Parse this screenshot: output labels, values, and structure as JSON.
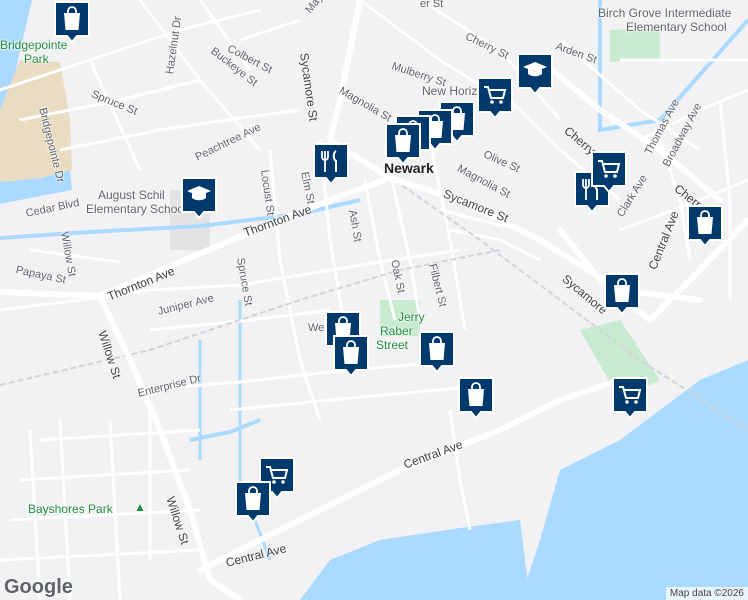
{
  "map": {
    "street_labels": [
      {
        "id": "mayhews",
        "text": "Mayhews"
      },
      {
        "id": "colbert",
        "text": "Colbert St"
      },
      {
        "id": "buckeye",
        "text": "Buckeye St"
      },
      {
        "id": "hazelnut",
        "text": "Hazelnut Dr"
      },
      {
        "id": "spruce_n",
        "text": "Spruce St"
      },
      {
        "id": "peachtree",
        "text": "Peachtree Ave"
      },
      {
        "id": "bridgepointe_dr",
        "text": "Bridgepointe Dr"
      },
      {
        "id": "cedar",
        "text": "Cedar Blvd"
      },
      {
        "id": "willow_n",
        "text": "Willow St"
      },
      {
        "id": "papaya",
        "text": "Papaya St"
      },
      {
        "id": "sycamore_n",
        "text": "Sycamore St"
      },
      {
        "id": "magnolia_n",
        "text": "Magnolia St"
      },
      {
        "id": "mulberry",
        "text": "Mulberry St"
      },
      {
        "id": "locust",
        "text": "Locust St"
      },
      {
        "id": "elm",
        "text": "Elm St"
      },
      {
        "id": "thornton_e",
        "text": "Thornton Ave"
      },
      {
        "id": "thornton_w",
        "text": "Thornton Ave"
      },
      {
        "id": "spruce_s",
        "text": "Spruce St"
      },
      {
        "id": "juniper",
        "text": "Juniper Ave"
      },
      {
        "id": "ash",
        "text": "Ash St"
      },
      {
        "id": "oak",
        "text": "Oak St"
      },
      {
        "id": "filbert",
        "text": "Filbert St"
      },
      {
        "id": "we",
        "text": "We"
      },
      {
        "id": "willow_s",
        "text": "Willow St"
      },
      {
        "id": "enterprise",
        "text": "Enterprise Dr"
      },
      {
        "id": "central_mid",
        "text": "Central Ave"
      },
      {
        "id": "central_sw",
        "text": "Central Ave"
      },
      {
        "id": "central_ne",
        "text": "Central Ave"
      },
      {
        "id": "willow_se",
        "text": "Willow St"
      },
      {
        "id": "olive",
        "text": "Olive St"
      },
      {
        "id": "magnolia_e",
        "text": "Magnolia St"
      },
      {
        "id": "sycamore_e",
        "text": "Sycamore St"
      },
      {
        "id": "sycamore_far",
        "text": "Sycamore"
      },
      {
        "id": "cherry_n",
        "text": "Cherry St"
      },
      {
        "id": "arden",
        "text": "Arden St"
      },
      {
        "id": "cherry_e",
        "text": "Cherry St"
      },
      {
        "id": "thomas",
        "text": "Thomas Ave"
      },
      {
        "id": "broadway",
        "text": "Broadway Ave"
      },
      {
        "id": "clark",
        "text": "Clark Ave"
      },
      {
        "id": "cherr",
        "text": "Cherr"
      },
      {
        "id": "er_st",
        "text": "er St"
      }
    ],
    "place_labels": {
      "bridgepointe_park_1": "Bridgepointe",
      "bridgepointe_park_2": "Park",
      "august_1": "August Schil",
      "august_2": "Elementary Schoo",
      "birch_1": "Birch Grove Intermediate",
      "birch_2": "Elementary School",
      "new_horizons": "New Horizons",
      "newark": "Newark",
      "jerry_1": "Jerry",
      "jerry_2": "Raber",
      "jerry_3": "Street",
      "bayshores": "Bayshores Park"
    },
    "markers": [
      {
        "id": "m1",
        "type": "shopping-bag"
      },
      {
        "id": "m2",
        "type": "school-cap"
      },
      {
        "id": "m3",
        "type": "shopping-cart"
      },
      {
        "id": "m4",
        "type": "shopping-bag"
      },
      {
        "id": "m5",
        "type": "shopping-bag"
      },
      {
        "id": "m6",
        "type": "shopping-bag"
      },
      {
        "id": "m7",
        "type": "shopping-bag"
      },
      {
        "id": "m8",
        "type": "restaurant"
      },
      {
        "id": "m9",
        "type": "school-cap"
      },
      {
        "id": "m10",
        "type": "restaurant"
      },
      {
        "id": "m11",
        "type": "shopping-cart"
      },
      {
        "id": "m12",
        "type": "shopping-bag"
      },
      {
        "id": "m13",
        "type": "shopping-bag"
      },
      {
        "id": "m14",
        "type": "shopping-bag"
      },
      {
        "id": "m15",
        "type": "shopping-bag"
      },
      {
        "id": "m16",
        "type": "shopping-bag"
      },
      {
        "id": "m17",
        "type": "shopping-bag"
      },
      {
        "id": "m18",
        "type": "shopping-cart"
      },
      {
        "id": "m19",
        "type": "shopping-cart"
      },
      {
        "id": "m20",
        "type": "shopping-bag"
      }
    ],
    "colors": {
      "background": "#f2f1f4",
      "water": "#aadaff",
      "park": "#c8ebcf",
      "road": "#ffffff",
      "marker_fill": "#003a6c",
      "marker_border": "#ffffff"
    },
    "logo": "Google",
    "attribution": "Map data ©2026"
  }
}
